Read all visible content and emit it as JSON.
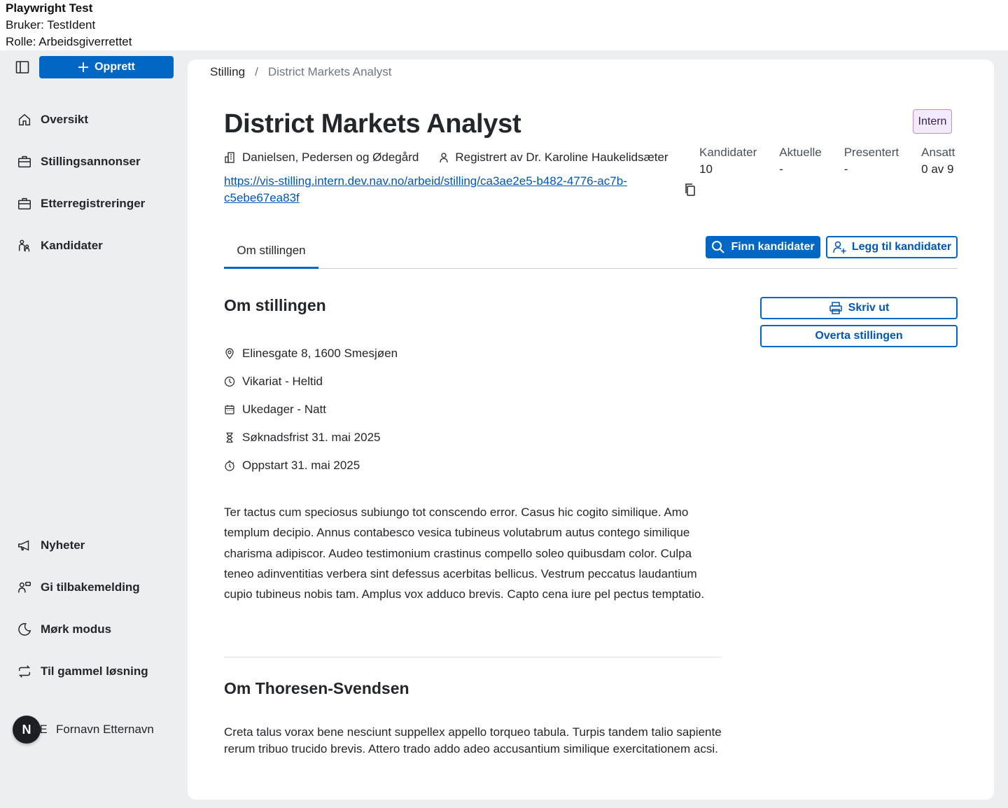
{
  "topinfo": {
    "title": "Playwright Test",
    "user": "Bruker: TestIdent",
    "role": "Rolle: Arbeidsgiverrettet"
  },
  "sidebar": {
    "create_label": "Opprett",
    "nav": [
      {
        "label": "Oversikt",
        "icon": "house-icon"
      },
      {
        "label": "Stillingsannonser",
        "icon": "briefcase-icon"
      },
      {
        "label": "Etterregistreringer",
        "icon": "briefcase-icon"
      },
      {
        "label": "Kandidater",
        "icon": "people-icon"
      }
    ],
    "bottom_nav": [
      {
        "label": "Nyheter",
        "icon": "megaphone-icon"
      },
      {
        "label": "Gi tilbakemelding",
        "icon": "feedback-icon"
      },
      {
        "label": "Mørk modus",
        "icon": "moon-icon"
      },
      {
        "label": "Til gammel løsning",
        "icon": "arrows-cycle-icon"
      }
    ],
    "user": {
      "initials": "FE",
      "avatar_letter": "N",
      "name": "Fornavn Etternavn"
    }
  },
  "breadcrumb": {
    "root": "Stilling",
    "separator": "/",
    "current": "District Markets Analyst"
  },
  "job": {
    "title": "District Markets Analyst",
    "tag": "Intern",
    "employer": "Danielsen, Pedersen og Ødegård",
    "registered_by": "Registrert av Dr. Karoline Haukelidsæter",
    "url": "https://vis-stilling.intern.dev.nav.no/arbeid/stilling/ca3ae2e5-b482-4776-ac7b-c5ebe67ea83f"
  },
  "stats": [
    {
      "label": "Kandidater",
      "value": "10"
    },
    {
      "label": "Aktuelle",
      "value": "-"
    },
    {
      "label": "Presentert",
      "value": "-"
    },
    {
      "label": "Ansatt",
      "value": "0 av 9"
    }
  ],
  "tabs": {
    "active": "Om stillingen"
  },
  "actions": {
    "find_candidates": "Finn kandidater",
    "add_candidates": "Legg til kandidater",
    "print": "Skriv ut",
    "take_over": "Overta stillingen"
  },
  "about": {
    "heading": "Om stillingen",
    "details": [
      {
        "icon": "location-pin-icon",
        "text": "Elinesgate 8, 1600 Smesjøen"
      },
      {
        "icon": "clock-icon",
        "text": "Vikariat - Heltid"
      },
      {
        "icon": "calendar-icon",
        "text": "Ukedager - Natt"
      },
      {
        "icon": "hourglass-icon",
        "text": "Søknadsfrist 31. mai 2025"
      },
      {
        "icon": "stopwatch-icon",
        "text": "Oppstart 31. mai 2025"
      }
    ],
    "description": "Ter tactus cum speciosus subiungo tot conscendo error. Casus hic cogito similique. Amo templum decipio. Annus contabesco vesica tubineus volutabrum autus contego similique charisma adipiscor. Audeo testimonium crastinus compello soleo quibusdam color. Culpa teneo adinventitias verbera sint defessus acerbitas bellicus. Vestrum peccatus laudantium cupio tubineus nobis tam. Amplus vox adduco brevis. Capto cena iure pel pectus temptatio."
  },
  "employer_section": {
    "heading": "Om Thoresen-Svendsen",
    "description": "Creta talus vorax bene nesciunt suppellex appello torqueo tabula. Turpis tandem talio sapiente rerum tribuo trucido brevis. Attero trado addo adeo accusantium similique exercitationem acsi."
  },
  "colors": {
    "accent": "#0067c5",
    "tag_bg": "#f3eaff",
    "tag_border": "#b98ed8",
    "shell_bg": "#eceef0"
  }
}
